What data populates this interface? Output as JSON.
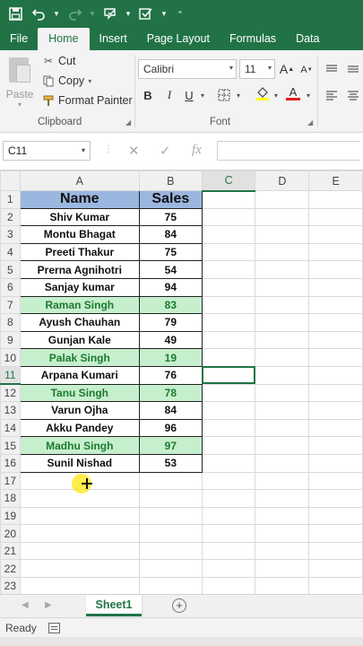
{
  "titlebar": {
    "icons": [
      "save-icon",
      "undo-icon",
      "redo-icon",
      "touch-mode-icon",
      "customize-icon"
    ]
  },
  "tabs": [
    "File",
    "Home",
    "Insert",
    "Page Layout",
    "Formulas",
    "Data"
  ],
  "active_tab": "Home",
  "clipboard": {
    "paste_label": "Paste",
    "cut_label": "Cut",
    "copy_label": "Copy",
    "format_painter_label": "Format Painter",
    "group_label": "Clipboard"
  },
  "font": {
    "font_name": "Calibri",
    "font_size": "11",
    "bold": "B",
    "italic": "I",
    "underline": "U",
    "increase_font": "A",
    "decrease_font": "A",
    "font_color_letter": "A",
    "group_label": "Font"
  },
  "formula_bar": {
    "name_box": "C11",
    "fx_label": "fx",
    "cancel_symbol": "✕",
    "enter_symbol": "✓",
    "value": ""
  },
  "columns": [
    "A",
    "B",
    "C",
    "D",
    "E"
  ],
  "selected_column": "C",
  "selected_row": "11",
  "table_header": {
    "name": "Name",
    "sales": "Sales"
  },
  "rows": [
    {
      "name": "Shiv Kumar",
      "sales": "75",
      "highlight": false
    },
    {
      "name": "Montu Bhagat",
      "sales": "84",
      "highlight": false
    },
    {
      "name": "Preeti Thakur",
      "sales": "75",
      "highlight": false
    },
    {
      "name": "Prerna Agnihotri",
      "sales": "54",
      "highlight": false
    },
    {
      "name": "Sanjay kumar",
      "sales": "94",
      "highlight": false
    },
    {
      "name": "Raman Singh",
      "sales": "83",
      "highlight": true
    },
    {
      "name": "Ayush Chauhan",
      "sales": "79",
      "highlight": false
    },
    {
      "name": "Gunjan Kale",
      "sales": "49",
      "highlight": false
    },
    {
      "name": "Palak Singh",
      "sales": "19",
      "highlight": true
    },
    {
      "name": "Arpana Kumari",
      "sales": "76",
      "highlight": false
    },
    {
      "name": "Tanu Singh",
      "sales": "78",
      "highlight": true
    },
    {
      "name": "Varun Ojha",
      "sales": "84",
      "highlight": false
    },
    {
      "name": "Akku Pandey",
      "sales": "96",
      "highlight": false
    },
    {
      "name": "Madhu Singh",
      "sales": "97",
      "highlight": true
    },
    {
      "name": "Sunil Nishad",
      "sales": "53",
      "highlight": false
    }
  ],
  "row_numbers": [
    "1",
    "2",
    "3",
    "4",
    "5",
    "6",
    "7",
    "8",
    "9",
    "10",
    "11",
    "12",
    "13",
    "14",
    "15",
    "16",
    "17",
    "18",
    "19",
    "20",
    "21",
    "22",
    "23"
  ],
  "sheet_tab": "Sheet1",
  "add_sheet": "+",
  "status": "Ready",
  "colors": {
    "excel_green": "#217346",
    "header_blue": "#9bb7e0",
    "highlight_green": "#c6efce",
    "highlight_text": "#1e7a2e"
  }
}
